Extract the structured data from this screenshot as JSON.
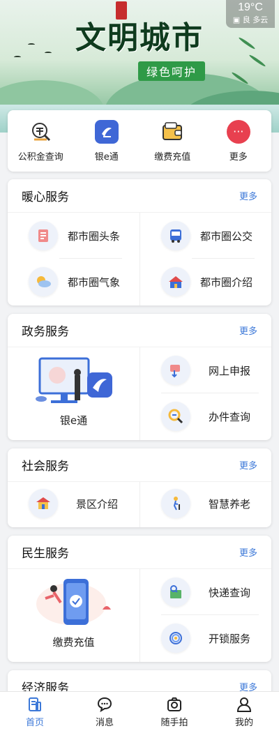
{
  "banner": {
    "title": "文明城市",
    "slogan": "绿色呵护",
    "weather": {
      "temp": "19°C",
      "air": "良",
      "condition": "多云"
    }
  },
  "quick": [
    {
      "label": "公积金查询",
      "icon": "fund-search-icon"
    },
    {
      "label": "银e通",
      "icon": "yin-e-tong-icon"
    },
    {
      "label": "缴费充值",
      "icon": "wallet-icon"
    },
    {
      "label": "更多",
      "icon": "more-icon"
    }
  ],
  "sections": {
    "warm": {
      "title": "暖心服务",
      "more": "更多",
      "items": [
        {
          "label": "都市圈头条",
          "icon": "news-icon"
        },
        {
          "label": "都市圈公交",
          "icon": "bus-icon"
        },
        {
          "label": "都市圈气象",
          "icon": "weather-icon"
        },
        {
          "label": "都市圈介绍",
          "icon": "city-icon"
        }
      ]
    },
    "gov": {
      "title": "政务服务",
      "more": "更多",
      "feature": "银e通",
      "items": [
        {
          "label": "网上申报",
          "icon": "online-apply-icon"
        },
        {
          "label": "办件查询",
          "icon": "magnifier-icon"
        }
      ]
    },
    "social": {
      "title": "社会服务",
      "more": "更多",
      "items": [
        {
          "label": "景区介绍",
          "icon": "scenic-icon"
        },
        {
          "label": "智慧养老",
          "icon": "elderly-icon"
        }
      ]
    },
    "life": {
      "title": "民生服务",
      "more": "更多",
      "feature": "缴费充值",
      "items": [
        {
          "label": "快递查询",
          "icon": "parcel-icon"
        },
        {
          "label": "开锁服务",
          "icon": "fingerprint-icon"
        }
      ]
    },
    "econ": {
      "title": "经济服务",
      "more": "更多"
    }
  },
  "nav": [
    {
      "label": "首页",
      "icon": "home-icon",
      "active": true
    },
    {
      "label": "消息",
      "icon": "message-icon"
    },
    {
      "label": "随手拍",
      "icon": "camera-icon"
    },
    {
      "label": "我的",
      "icon": "profile-icon"
    }
  ]
}
